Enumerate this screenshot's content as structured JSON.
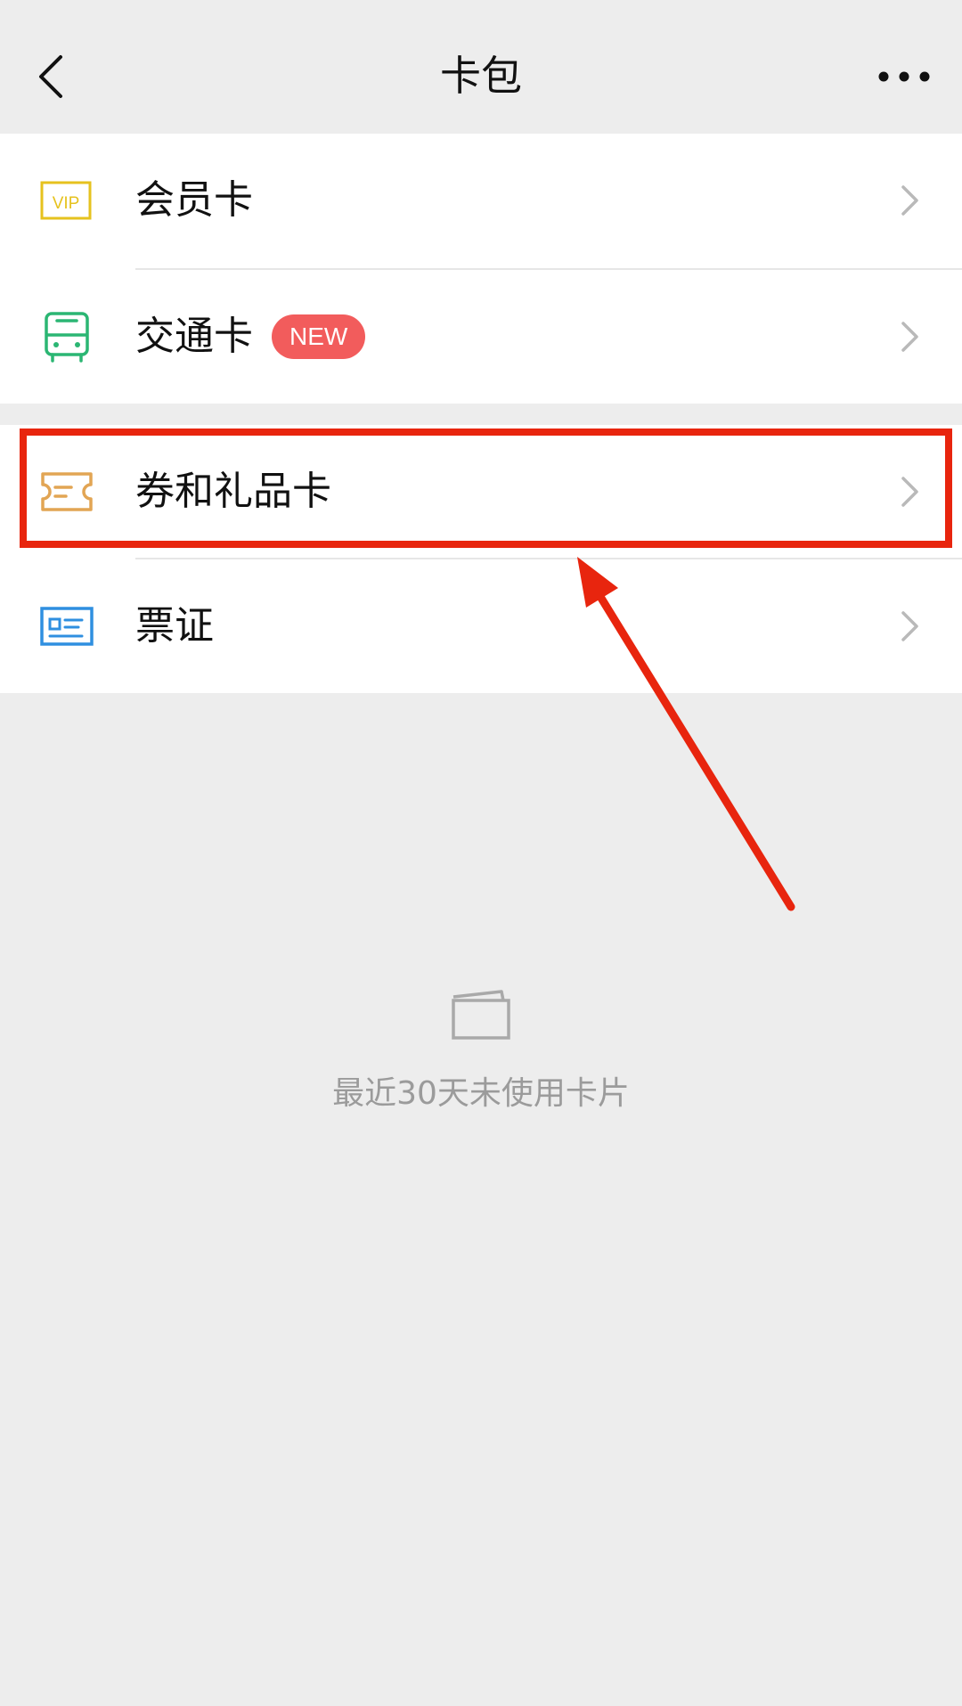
{
  "navbar": {
    "title": "卡包",
    "back_icon": "chevron-left-icon",
    "more_icon": "more-dots-icon"
  },
  "menu": [
    {
      "label": "会员卡",
      "icon": "vip-card-icon",
      "icon_text": "VIP",
      "color": "#e6c21e"
    },
    {
      "label": "交通卡",
      "icon": "bus-icon",
      "badge": "NEW",
      "color": "#2bb673"
    },
    {
      "label": "券和礼品卡",
      "icon": "ticket-icon",
      "color": "#e2a554"
    },
    {
      "label": "票证",
      "icon": "id-card-icon",
      "color": "#2f8fe0"
    }
  ],
  "empty_state": {
    "icon": "empty-card-icon",
    "text": "最近30天未使用卡片"
  },
  "colors": {
    "background": "#ededed",
    "badge": "#f25c5c",
    "annotation": "#e8250e"
  }
}
